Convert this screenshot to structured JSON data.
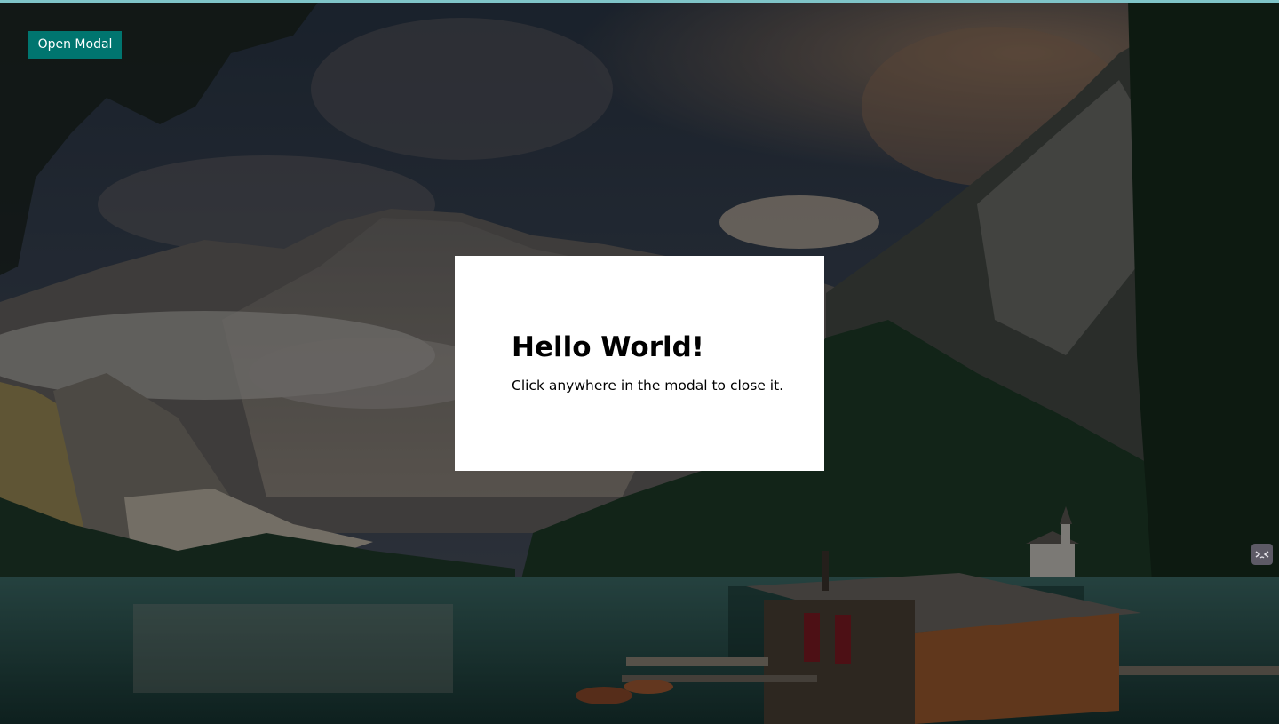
{
  "page": {
    "open_button_label": "Open Modal",
    "accent_color": "#00756f"
  },
  "modal": {
    "title": "Hello World!",
    "body": "Click anywhere in the modal to close it."
  },
  "background": {
    "description_icon": "landscape-photo",
    "widget_icon": "sleepy-face-icon"
  }
}
